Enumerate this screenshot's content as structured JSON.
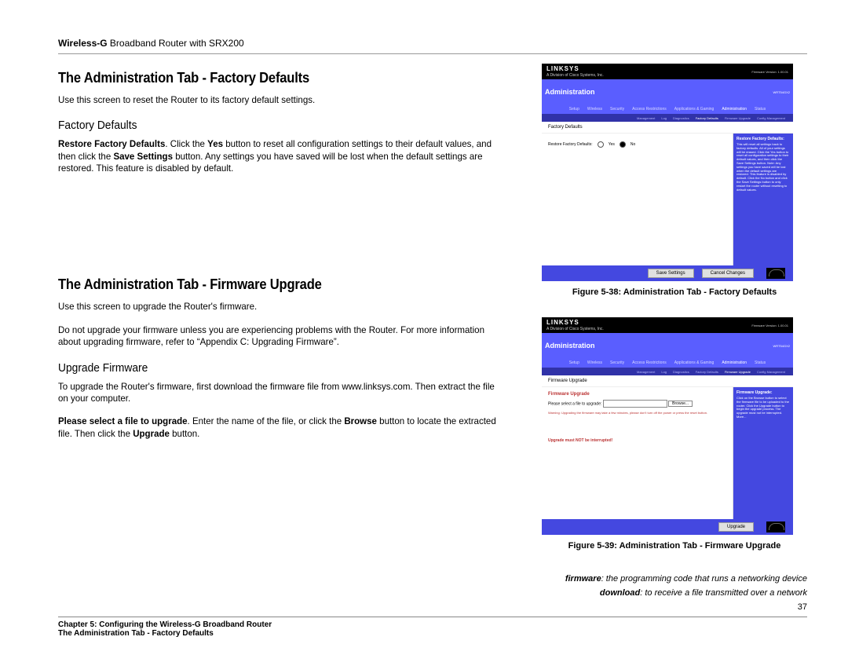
{
  "header": {
    "product_bold": "Wireless-G",
    "product_rest": " Broadband Router with SRX200"
  },
  "section1": {
    "title": "The Administration Tab - Factory Defaults",
    "intro": "Use this screen to reset the Router to its factory default settings.",
    "sub_title": "Factory Defaults",
    "para_bold1": "Restore Factory Defaults",
    "para_txt1": ". Click the ",
    "para_bold2": "Yes",
    "para_txt2": " button to reset all configuration settings to their default values, and then click the ",
    "para_bold3": "Save Settings",
    "para_txt3": " button. Any settings you have saved will be lost when the default settings are restored. This feature is disabled by default."
  },
  "section2": {
    "title": "The Administration Tab - Firmware Upgrade",
    "intro": "Use this screen to upgrade the Router's firmware.",
    "warn": "Do not upgrade your firmware unless you are experiencing problems with the Router. For more information about upgrading firmware, refer to “Appendix C: Upgrading Firmware”.",
    "sub_title": "Upgrade Firmware",
    "p1": "To upgrade the Router's firmware, first download the firmware file from www.linksys.com. Then extract the file on your computer.",
    "p2_bold1": "Please select a file to upgrade",
    "p2_txt1": ". Enter the name of the file, or click the ",
    "p2_bold2": "Browse",
    "p2_txt2": " button to locate the extracted file. Then click the ",
    "p2_bold3": "Upgrade",
    "p2_txt3": " button."
  },
  "figures": {
    "brand": "LINKSYS",
    "sub_brand": "A Division of Cisco Systems, Inc.",
    "admin_label": "Administration",
    "fw_version": "Firmware Version: 1.00.01",
    "model": "WRT54GX2",
    "main_tabs": [
      "Setup",
      "Wireless",
      "Security",
      "Access Restrictions",
      "Applications & Gaming",
      "Administration",
      "Status"
    ],
    "subtabs1": [
      "Management",
      "Log",
      "Diagnostics",
      "Factory Defaults",
      "Firmware Upgrade",
      "Config Management"
    ],
    "fig1": {
      "side_label": "Factory Defaults",
      "row_label": "Restore Factory Defaults:",
      "yes": "Yes",
      "no": "No",
      "save_btn": "Save Settings",
      "cancel_btn": "Cancel Changes",
      "help_title": "Restore Factory Defaults:",
      "help_text": "This will reset all settings back to factory defaults. All of your settings will be erased. Click the Yes button to reset all configuration settings to their default values, and then click the Save Settings button. Note: Any settings you have saved will be lost when the default settings are restored. This feature is disabled by default. Click the No button and click the Save Settings button to only restart the router without resetting to default values.",
      "caption": "Figure 5-38: Administration Tab - Factory Defaults"
    },
    "fig2": {
      "side_label": "Firmware Upgrade",
      "heading": "Firmware Upgrade",
      "select_label": "Please select a file to upgrade:",
      "browse_btn": "Browse...",
      "warning": "Warning: Upgrading the firmware may take a few minutes, please don't turn off the power or press the reset button.",
      "no_interrupt": "Upgrade must NOT be interrupted!",
      "upgrade_btn": "Upgrade",
      "help_title": "Firmware Upgrade:",
      "help_text": "Click on the Browse button to select the firmware file to be uploaded to the router. Click the Upgrade button to begin the upgrade process. The upgrade must not be interrupted. More...",
      "caption": "Figure 5-39: Administration Tab - Firmware Upgrade"
    }
  },
  "glossary": {
    "g1_term": "firmware",
    "g1_def": ": the programming code that runs a networking device",
    "g2_term": "download",
    "g2_def": ": to receive a file transmitted over a network"
  },
  "footer": {
    "chapter": "Chapter 5: Configuring the Wireless-G Broadband Router",
    "section": "The Administration Tab - Factory Defaults",
    "page_num": "37"
  }
}
